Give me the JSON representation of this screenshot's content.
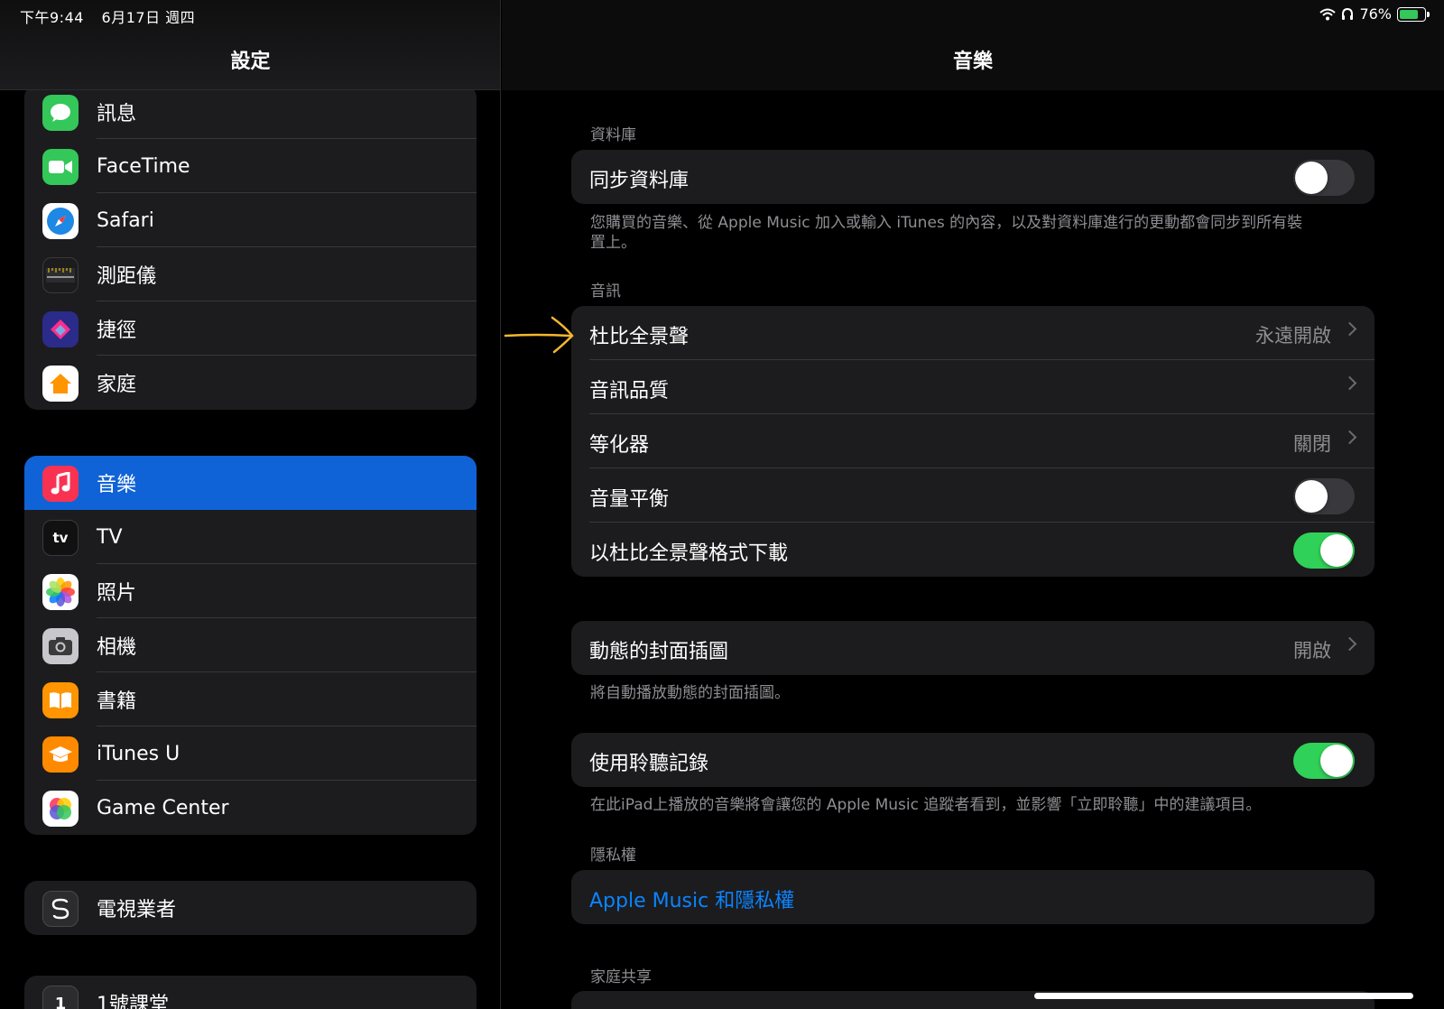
{
  "status": {
    "time": "下午9:44",
    "date": "6月17日 週四",
    "battery": "76%"
  },
  "sidebar": {
    "title": "設定",
    "group1": [
      {
        "label": "訊息",
        "icon": "messages-icon",
        "color": "#34c759"
      },
      {
        "label": "FaceTime",
        "icon": "facetime-icon",
        "color": "#34c759"
      },
      {
        "label": "Safari",
        "icon": "safari-icon",
        "color": "#1e88e5"
      },
      {
        "label": "測距儀",
        "icon": "measure-icon",
        "color": "#1c1c1e"
      },
      {
        "label": "捷徑",
        "icon": "shortcuts-icon",
        "color": "#3a3aa8"
      },
      {
        "label": "家庭",
        "icon": "home-icon",
        "color": "#ffffff"
      }
    ],
    "group2": [
      {
        "label": "音樂",
        "icon": "music-icon",
        "color": "#fa3252",
        "selected": true
      },
      {
        "label": "TV",
        "icon": "tv-icon",
        "color": "#111111"
      },
      {
        "label": "照片",
        "icon": "photos-icon",
        "color": "#ffffff"
      },
      {
        "label": "相機",
        "icon": "camera-icon",
        "color": "#8e8e93"
      },
      {
        "label": "書籍",
        "icon": "books-icon",
        "color": "#ff9500"
      },
      {
        "label": "iTunes U",
        "icon": "itunes-u-icon",
        "color": "#ff8a00"
      },
      {
        "label": "Game Center",
        "icon": "game-center-icon",
        "color": "#ffffff"
      }
    ],
    "group3": [
      {
        "label": "電視業者",
        "icon": "tv-provider-icon",
        "color": "#2c2c2e"
      }
    ],
    "group4": [
      {
        "label": "1號課堂",
        "icon": "classroom-icon",
        "color": "#2c2c2e"
      }
    ]
  },
  "main": {
    "title": "音樂",
    "library_label": "資料庫",
    "sync_library": "同步資料庫",
    "sync_note": "您購買的音樂、從 Apple Music 加入或輸入 iTunes 的內容，以及對資料庫進行的更動都會同步到所有裝置上。",
    "audio_label": "音訊",
    "dolby_atmos": "杜比全景聲",
    "dolby_atmos_value": "永遠開啟",
    "audio_quality": "音訊品質",
    "eq": "等化器",
    "eq_value": "關閉",
    "sound_check": "音量平衡",
    "download_dolby": "以杜比全景聲格式下載",
    "animated_art": "動態的封面插圖",
    "animated_art_value": "開啟",
    "animated_art_note": "將自動播放動態的封面插圖。",
    "listening_history": "使用聆聽記錄",
    "listening_note": "在此iPad上播放的音樂將會讓您的 Apple Music 追蹤者看到，並影響「立即聆聽」中的建議項目。",
    "privacy_label": "隱私權",
    "privacy_link": "Apple Music 和隱私權",
    "family_label": "家庭共享"
  },
  "toggles": {
    "sync_library": false,
    "sound_check": false,
    "download_dolby": true,
    "listening_history": true
  }
}
